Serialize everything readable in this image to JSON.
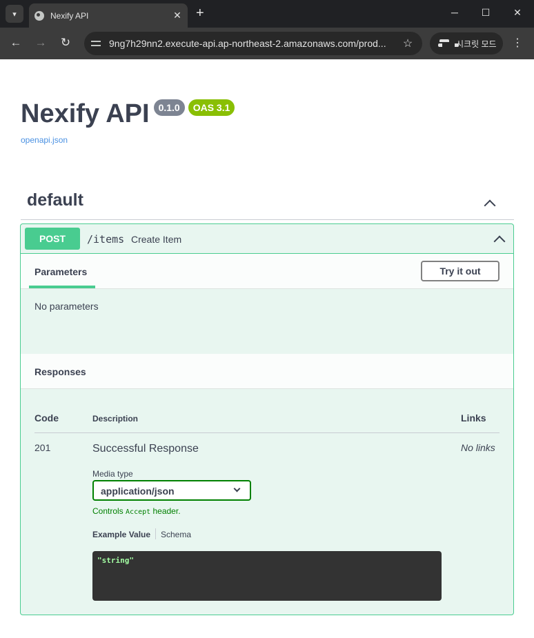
{
  "browser": {
    "tab_title": "Nexify API",
    "url": "9ng7h29nn2.execute-api.ap-northeast-2.amazonaws.com/prod...",
    "incognito_label": "시크릿 모드"
  },
  "api": {
    "title": "Nexify API",
    "version_badge": "0.1.0",
    "oas_badge": "OAS 3.1",
    "spec_link": "openapi.json"
  },
  "section": {
    "title": "default"
  },
  "operation": {
    "method": "POST",
    "path": "/items",
    "summary": "Create Item",
    "parameters_tab": "Parameters",
    "try_button": "Try it out",
    "no_params": "No parameters",
    "responses_title": "Responses",
    "columns": {
      "code": "Code",
      "description": "Description",
      "links": "Links"
    },
    "response": {
      "code": "201",
      "description": "Successful Response",
      "links": "No links",
      "media_type_label": "Media type",
      "media_type_value": "application/json",
      "controls_prefix": "Controls ",
      "controls_code": "Accept",
      "controls_suffix": " header.",
      "example_tab": "Example Value",
      "schema_tab": "Schema",
      "example_value": "\"string\""
    }
  },
  "colors": {
    "post_method": "#49cc90",
    "post_background": "#e8f6f0",
    "version_badge": "#7d8492",
    "oas_badge": "#89bf04",
    "link": "#4990e2"
  }
}
